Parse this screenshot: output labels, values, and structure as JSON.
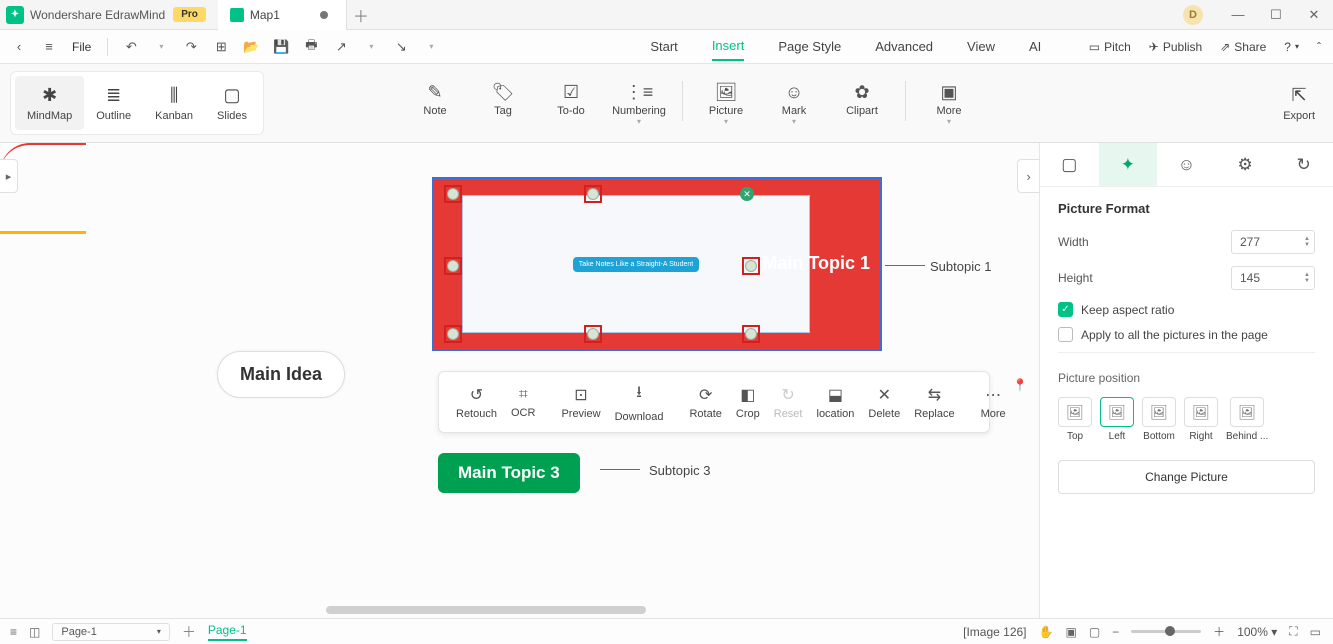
{
  "app": {
    "title": "Wondershare EdrawMind",
    "badge": "Pro",
    "user_initial": "D"
  },
  "tab": {
    "name": "Map1"
  },
  "menu": {
    "file": "File",
    "tabs": [
      "Start",
      "Insert",
      "Page Style",
      "Advanced",
      "View",
      "AI"
    ],
    "right": {
      "pitch": "Pitch",
      "publish": "Publish",
      "share": "Share"
    }
  },
  "view_modes": {
    "mindmap": "MindMap",
    "outline": "Outline",
    "kanban": "Kanban",
    "slides": "Slides"
  },
  "insert_tools": {
    "note": "Note",
    "tag": "Tag",
    "todo": "To-do",
    "numbering": "Numbering",
    "picture": "Picture",
    "mark": "Mark",
    "clipart": "Clipart",
    "more": "More"
  },
  "export": "Export",
  "nodes": {
    "main_idea": "Main Idea",
    "main_topic_1": "Main Topic 1",
    "subtopic_1": "Subtopic 1",
    "main_topic_3": "Main Topic 3",
    "subtopic_3": "Subtopic 3",
    "embedded_title": "Take Notes Like a Straight-A Student"
  },
  "float_toolbar": {
    "retouch": "Retouch",
    "ocr": "OCR",
    "preview": "Preview",
    "download": "Download",
    "rotate": "Rotate",
    "crop": "Crop",
    "reset": "Reset",
    "location": "location",
    "delete": "Delete",
    "replace": "Replace",
    "more": "More"
  },
  "panel": {
    "title": "Picture Format",
    "width_label": "Width",
    "width_value": "277",
    "height_label": "Height",
    "height_value": "145",
    "keep_aspect": "Keep aspect ratio",
    "apply_all": "Apply to all the pictures in the page",
    "position_label": "Picture position",
    "positions": {
      "top": "Top",
      "left": "Left",
      "bottom": "Bottom",
      "right": "Right",
      "behind": "Behind ..."
    },
    "change": "Change Picture"
  },
  "status": {
    "page_select": "Page-1",
    "page_active": "Page-1",
    "image_info": "[Image 126]",
    "zoom": "100%"
  }
}
